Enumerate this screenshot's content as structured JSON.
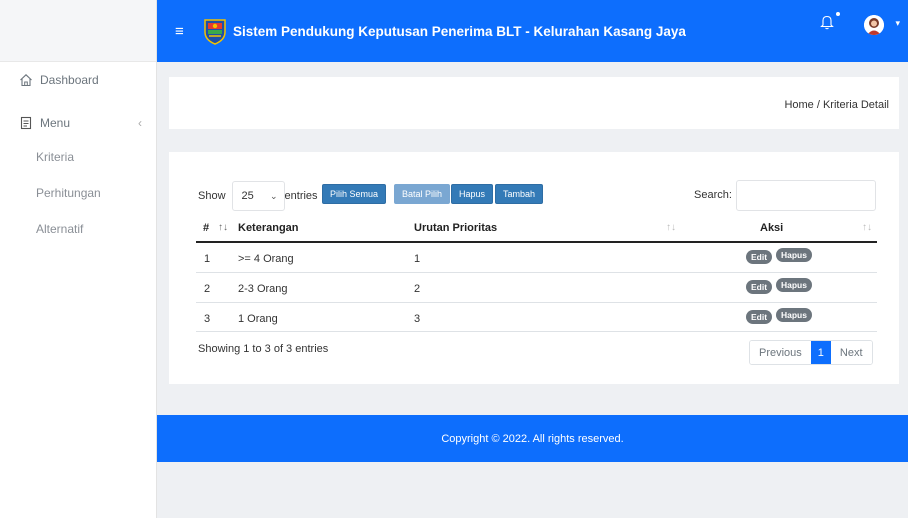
{
  "navbar": {
    "title": "Sistem Pendukung Keputusan Penerima BLT - Kelurahan Kasang Jaya",
    "brand_color": "#0d6efd"
  },
  "sidebar": {
    "items": [
      {
        "label": "Dashboard",
        "icon": "home-icon"
      },
      {
        "label": "Menu",
        "icon": "document-icon"
      }
    ],
    "submenu": [
      "Kriteria",
      "Perhitungan",
      "Alternatif"
    ]
  },
  "breadcrumb": "Home / Kriteria Detail",
  "table_controls": {
    "show_label": "Show",
    "entries_value": "25",
    "entries_label": "entries",
    "buttons": [
      "Pilih Semua",
      "Batal Pilih",
      "Hapus",
      "Tambah"
    ],
    "search_label": "Search:"
  },
  "table": {
    "headers": [
      "#",
      "Keterangan",
      "Urutan Prioritas",
      "Aksi"
    ],
    "rows": [
      {
        "no": "1",
        "keterangan": ">= 4 Orang",
        "urutan": "1"
      },
      {
        "no": "2",
        "keterangan": "2-3 Orang",
        "urutan": "2"
      },
      {
        "no": "3",
        "keterangan": "1 Orang",
        "urutan": "3"
      }
    ],
    "action_labels": {
      "edit": "Edit",
      "delete": "Hapus"
    }
  },
  "info": "Showing 1 to 3 of 3 entries",
  "pagination": {
    "previous": "Previous",
    "current": "1",
    "next": "Next"
  },
  "footer": "Copyright © 2022. All rights reserved."
}
